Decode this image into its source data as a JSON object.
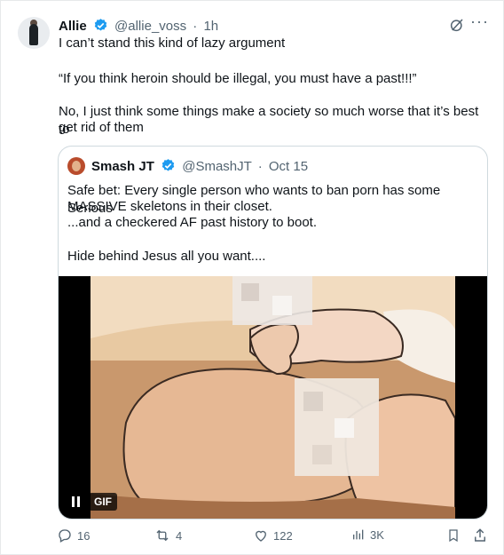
{
  "post": {
    "author_name": "Allie",
    "author_handle": "@allie_voss",
    "separator": "·",
    "time": "1h",
    "lines": [
      "I can’t stand this kind of lazy argument",
      "“If you think heroin should be illegal, you must have a past!!!”",
      "No, I just think some things make a society so much worse that it’s best to",
      "get rid of them"
    ]
  },
  "quote": {
    "author_name": "Smash JT",
    "author_handle": "@SmashJT",
    "separator": "·",
    "date": "Oct 15",
    "lines": [
      "Safe bet: Every single person who wants to ban porn has some Serious",
      "MASSIVE skeletons in their closet.",
      "...and a checkered AF past history to boot.",
      "Hide behind Jesus all you want...."
    ],
    "media": {
      "badge": "GIF"
    }
  },
  "actions": {
    "replies": "16",
    "reposts": "4",
    "likes": "122",
    "views": "3K"
  },
  "colors": {
    "accent": "#1d9bf0",
    "secondary_text": "#536471",
    "border": "#cfd9de"
  },
  "icons": [
    "grok-icon",
    "more-icon",
    "verified-badge-icon",
    "pause-icon",
    "reply-icon",
    "repost-icon",
    "like-icon",
    "views-icon",
    "bookmark-icon",
    "share-icon"
  ]
}
